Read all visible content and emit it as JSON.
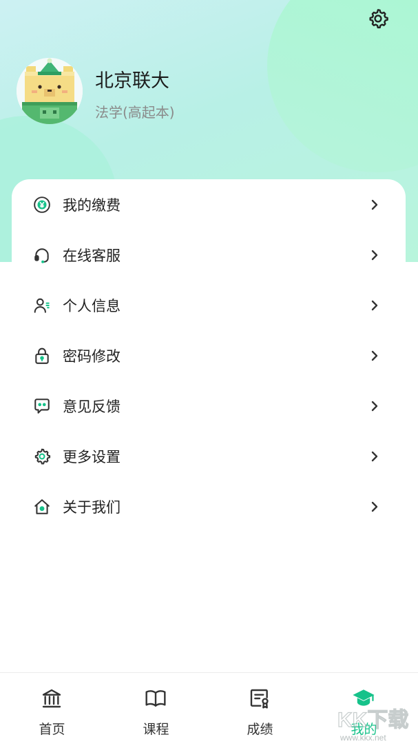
{
  "profile": {
    "name": "北京联大",
    "major": "法学(高起本)"
  },
  "header": {
    "settings_icon": "gear-icon"
  },
  "menu": {
    "items": [
      {
        "label": "我的缴费",
        "icon": "yen-coin-icon"
      },
      {
        "label": "在线客服",
        "icon": "headset-icon"
      },
      {
        "label": "个人信息",
        "icon": "user-info-icon"
      },
      {
        "label": "密码修改",
        "icon": "lock-icon"
      },
      {
        "label": "意见反馈",
        "icon": "feedback-chat-icon"
      },
      {
        "label": "更多设置",
        "icon": "gear-icon"
      },
      {
        "label": "关于我们",
        "icon": "home-icon"
      }
    ]
  },
  "tabs": {
    "items": [
      {
        "label": "首页",
        "icon": "bank-icon"
      },
      {
        "label": "课程",
        "icon": "book-icon"
      },
      {
        "label": "成绩",
        "icon": "certificate-icon"
      },
      {
        "label": "我的",
        "icon": "graduation-cap-icon",
        "active": true
      }
    ]
  },
  "watermark": {
    "text": "KK下载",
    "url_text": "www.kkx.net"
  },
  "colors": {
    "accent": "#16c28a",
    "icon": "#333333"
  }
}
